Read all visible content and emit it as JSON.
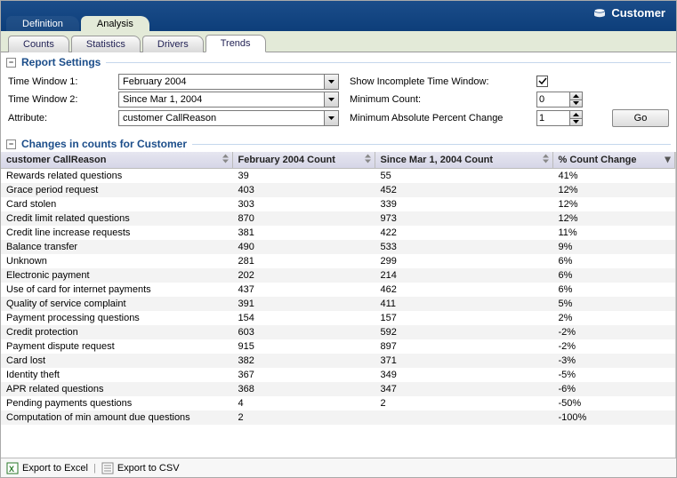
{
  "header": {
    "title": "Customer"
  },
  "tabs": {
    "top": [
      {
        "label": "Definition",
        "active": false
      },
      {
        "label": "Analysis",
        "active": true
      }
    ],
    "sub": [
      {
        "label": "Counts",
        "active": false
      },
      {
        "label": "Statistics",
        "active": false
      },
      {
        "label": "Drivers",
        "active": false
      },
      {
        "label": "Trends",
        "active": true
      }
    ]
  },
  "settings": {
    "group_title": "Report Settings",
    "time_window_1_label": "Time Window 1:",
    "time_window_1_value": "February 2004",
    "time_window_2_label": "Time Window 2:",
    "time_window_2_value": "Since Mar 1, 2004",
    "attribute_label": "Attribute:",
    "attribute_value": "customer CallReason",
    "show_incomplete_label": "Show Incomplete Time Window:",
    "show_incomplete_checked": true,
    "min_count_label": "Minimum Count:",
    "min_count_value": "0",
    "min_pct_label": "Minimum Absolute Percent Change",
    "min_pct_value": "1",
    "go_label": "Go"
  },
  "table": {
    "group_title": "Changes in counts for Customer",
    "columns": [
      "customer CallReason",
      "February 2004 Count",
      "Since Mar 1, 2004 Count",
      "% Count Change"
    ],
    "rows": [
      {
        "reason": "Rewards related questions",
        "c1": "39",
        "c2": "55",
        "pct": "41%"
      },
      {
        "reason": "Grace period request",
        "c1": "403",
        "c2": "452",
        "pct": "12%"
      },
      {
        "reason": "Card stolen",
        "c1": "303",
        "c2": "339",
        "pct": "12%"
      },
      {
        "reason": "Credit limit related questions",
        "c1": "870",
        "c2": "973",
        "pct": "12%"
      },
      {
        "reason": "Credit line increase requests",
        "c1": "381",
        "c2": "422",
        "pct": "11%"
      },
      {
        "reason": "Balance transfer",
        "c1": "490",
        "c2": "533",
        "pct": "9%"
      },
      {
        "reason": "Unknown",
        "c1": "281",
        "c2": "299",
        "pct": "6%"
      },
      {
        "reason": "Electronic payment",
        "c1": "202",
        "c2": "214",
        "pct": "6%"
      },
      {
        "reason": "Use of card for internet payments",
        "c1": "437",
        "c2": "462",
        "pct": "6%"
      },
      {
        "reason": "Quality of service complaint",
        "c1": "391",
        "c2": "411",
        "pct": "5%"
      },
      {
        "reason": "Payment processing questions",
        "c1": "154",
        "c2": "157",
        "pct": "2%"
      },
      {
        "reason": "Credit protection",
        "c1": "603",
        "c2": "592",
        "pct": "-2%"
      },
      {
        "reason": "Payment dispute request",
        "c1": "915",
        "c2": "897",
        "pct": "-2%"
      },
      {
        "reason": "Card lost",
        "c1": "382",
        "c2": "371",
        "pct": "-3%"
      },
      {
        "reason": "Identity theft",
        "c1": "367",
        "c2": "349",
        "pct": "-5%"
      },
      {
        "reason": "APR related questions",
        "c1": "368",
        "c2": "347",
        "pct": "-6%"
      },
      {
        "reason": "Pending payments questions",
        "c1": "4",
        "c2": "2",
        "pct": "-50%"
      },
      {
        "reason": "Computation of min amount due questions",
        "c1": "2",
        "c2": "",
        "pct": "-100%"
      }
    ]
  },
  "footer": {
    "export_excel_label": "Export to Excel",
    "export_csv_label": "Export to CSV"
  }
}
